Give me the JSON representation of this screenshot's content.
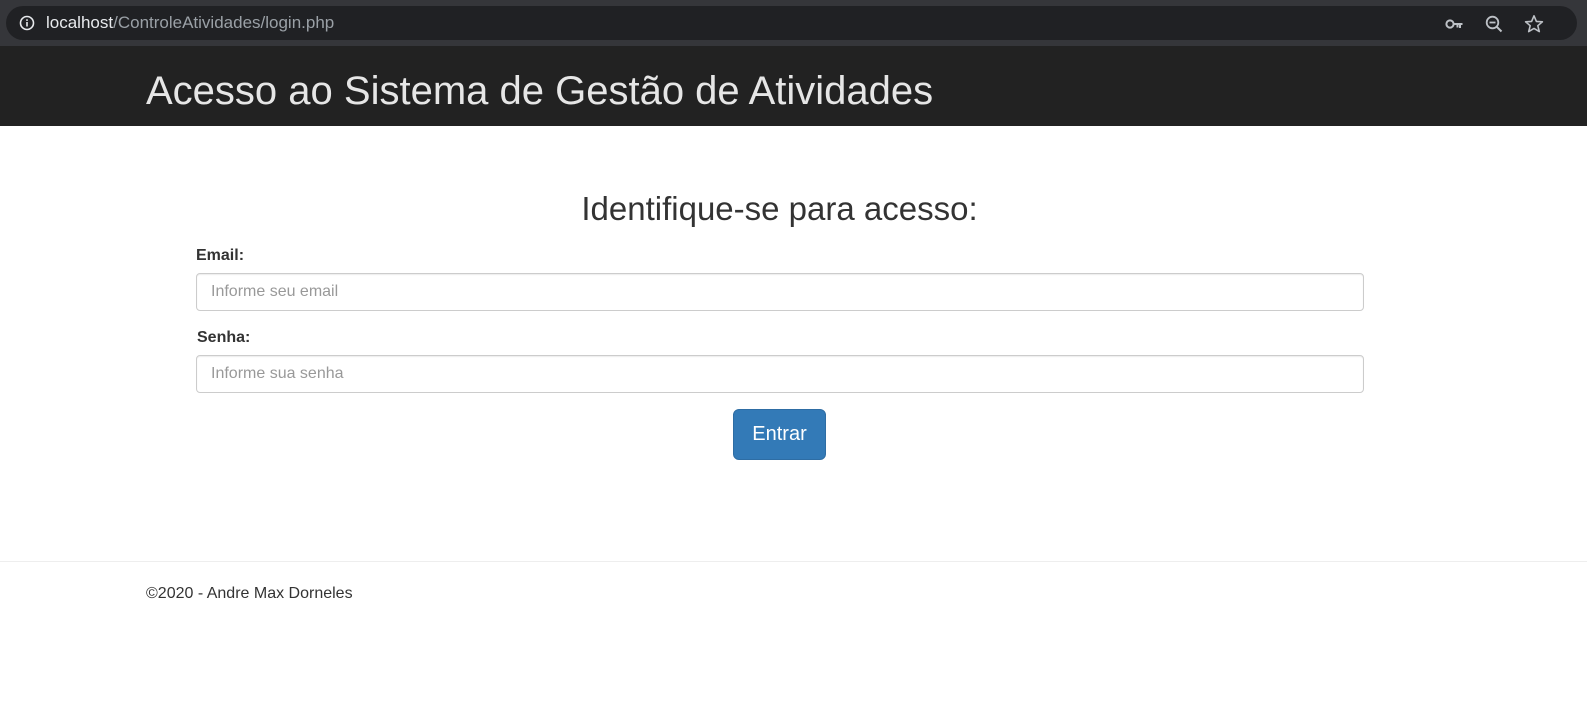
{
  "browser": {
    "url_host": "localhost",
    "url_path": "/ControleAtividades/login.php",
    "icons": [
      "info-icon",
      "key-icon",
      "zoom-out-icon",
      "star-icon"
    ]
  },
  "header": {
    "title": "Acesso ao Sistema de Gestão de Atividades"
  },
  "form": {
    "heading": "Identifique-se para acesso:",
    "email": {
      "label": "Email:",
      "placeholder": "Informe seu email",
      "value": ""
    },
    "password": {
      "label": "Senha:",
      "placeholder": "Informe sua senha",
      "value": ""
    },
    "submit_label": "Entrar"
  },
  "footer": {
    "text": "©2020 - Andre Max Dorneles"
  },
  "colors": {
    "header_bg": "#222222",
    "primary_button": "#337ab7",
    "browser_chrome": "#35363a",
    "omnibox": "#202124"
  }
}
